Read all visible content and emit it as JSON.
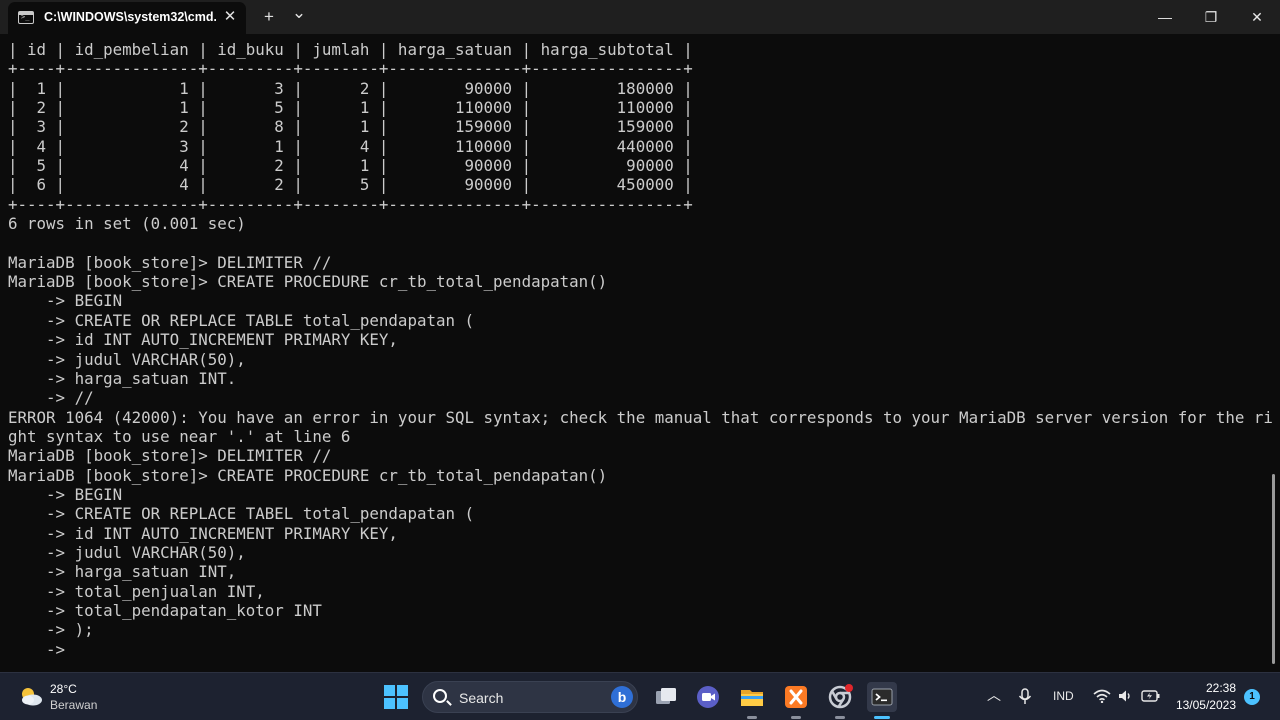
{
  "window": {
    "tab_title": "C:\\WINDOWS\\system32\\cmd.",
    "close_tab_glyph": "✕",
    "new_tab_glyph": "+",
    "dropdown_glyph": "⌄",
    "minimize_glyph": "—",
    "maximize_glyph": "❐",
    "close_glyph": "✕"
  },
  "terminal": {
    "lines": [
      "| id | id_pembelian | id_buku | jumlah | harga_satuan | harga_subtotal |",
      "+----+--------------+---------+--------+--------------+----------------+",
      "|  1 |            1 |       3 |      2 |        90000 |         180000 |",
      "|  2 |            1 |       5 |      1 |       110000 |         110000 |",
      "|  3 |            2 |       8 |      1 |       159000 |         159000 |",
      "|  4 |            3 |       1 |      4 |       110000 |         440000 |",
      "|  5 |            4 |       2 |      1 |        90000 |          90000 |",
      "|  6 |            4 |       2 |      5 |        90000 |         450000 |",
      "+----+--------------+---------+--------+--------------+----------------+",
      "6 rows in set (0.001 sec)",
      "",
      "MariaDB [book_store]> DELIMITER //",
      "MariaDB [book_store]> CREATE PROCEDURE cr_tb_total_pendapatan()",
      "    -> BEGIN",
      "    -> CREATE OR REPLACE TABLE total_pendapatan (",
      "    -> id INT AUTO_INCREMENT PRIMARY KEY,",
      "    -> judul VARCHAR(50),",
      "    -> harga_satuan INT.",
      "    -> //",
      "ERROR 1064 (42000): You have an error in your SQL syntax; check the manual that corresponds to your MariaDB server version for the ri",
      "ght syntax to use near '.' at line 6",
      "MariaDB [book_store]> DELIMITER //",
      "MariaDB [book_store]> CREATE PROCEDURE cr_tb_total_pendapatan()",
      "    -> BEGIN",
      "    -> CREATE OR REPLACE TABEL total_pendapatan (",
      "    -> id INT AUTO_INCREMENT PRIMARY KEY,",
      "    -> judul VARCHAR(50),",
      "    -> harga_satuan INT,",
      "    -> total_penjualan INT,",
      "    -> total_pendapatan_kotor INT",
      "    -> );",
      "    ->"
    ]
  },
  "taskbar": {
    "weather_temp": "28°C",
    "weather_desc": "Berawan",
    "search_placeholder": "Search",
    "language": "IND",
    "time": "22:38",
    "date": "13/05/2023",
    "notification_count": "1"
  }
}
